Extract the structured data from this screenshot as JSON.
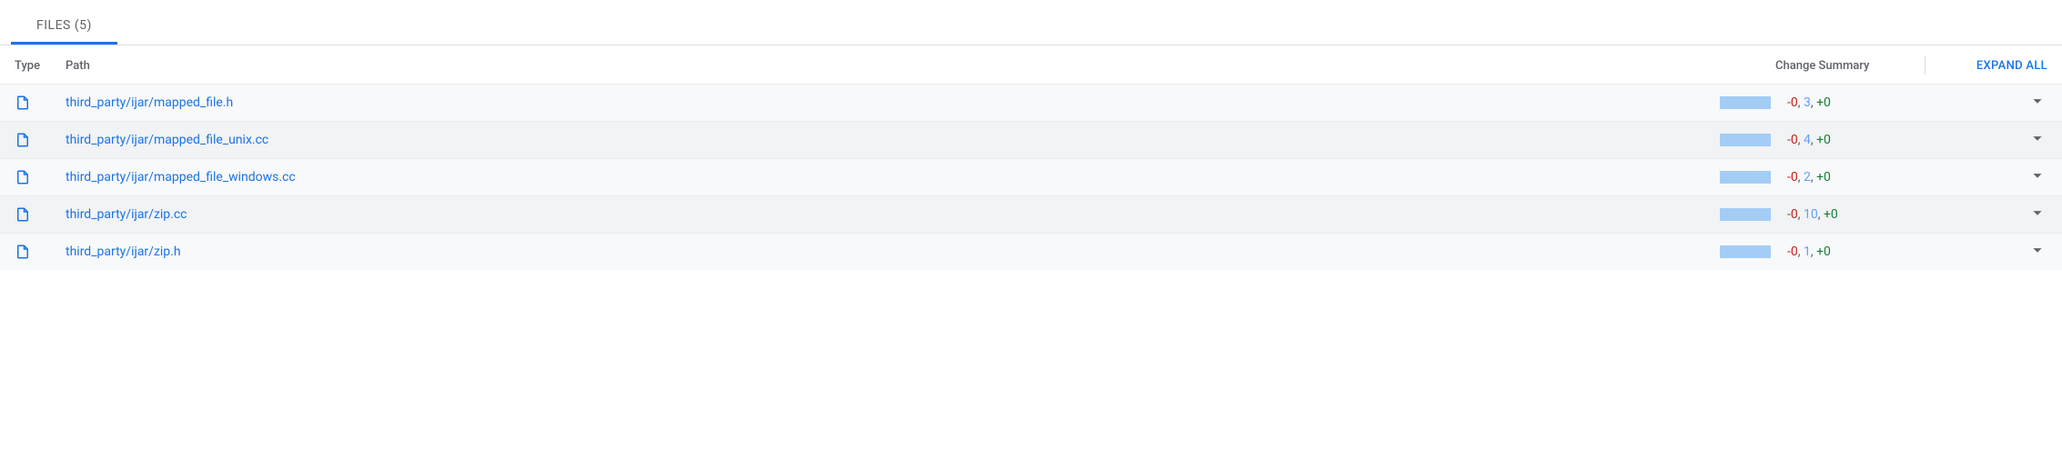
{
  "tab": {
    "label": "FILES",
    "count": 5
  },
  "headers": {
    "type": "Type",
    "path": "Path",
    "change_summary": "Change Summary",
    "expand_all": "EXPAND ALL"
  },
  "files": [
    {
      "path": "third_party/ijar/mapped_file.h",
      "deleted": 0,
      "modified": 3,
      "added": 0
    },
    {
      "path": "third_party/ijar/mapped_file_unix.cc",
      "deleted": 0,
      "modified": 4,
      "added": 0
    },
    {
      "path": "third_party/ijar/mapped_file_windows.cc",
      "deleted": 0,
      "modified": 2,
      "added": 0
    },
    {
      "path": "third_party/ijar/zip.cc",
      "deleted": 0,
      "modified": 10,
      "added": 0
    },
    {
      "path": "third_party/ijar/zip.h",
      "deleted": 0,
      "modified": 1,
      "added": 0
    }
  ]
}
